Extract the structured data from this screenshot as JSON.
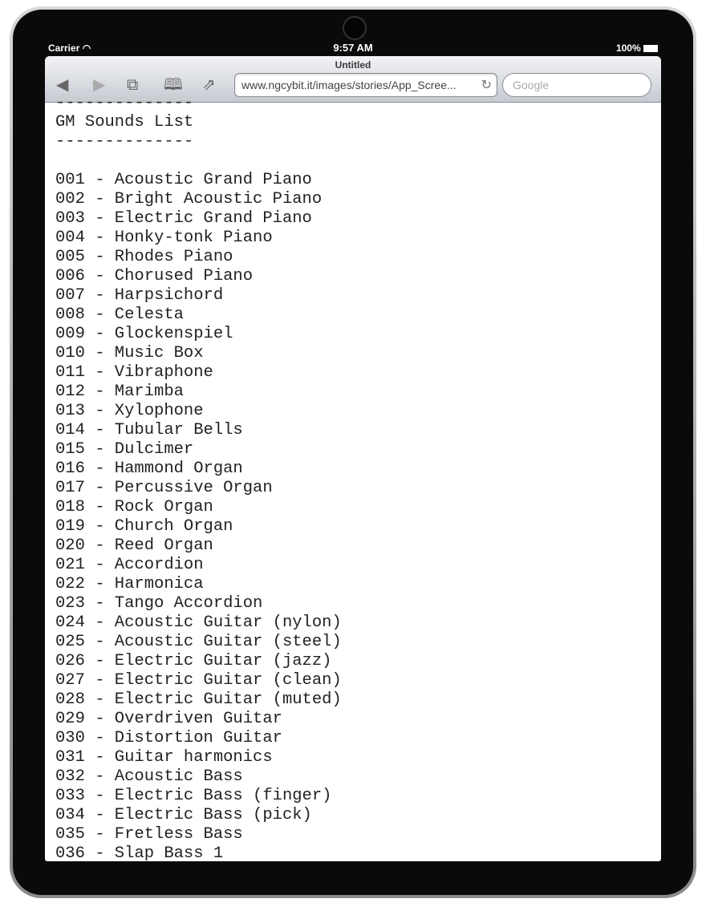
{
  "status": {
    "carrier": "Carrier",
    "time": "9:57 AM",
    "battery": "100%"
  },
  "browser": {
    "title": "Untitled",
    "url": "www.ngcybit.it/images/stories/App_Scree...",
    "search_placeholder": "Google"
  },
  "content": {
    "lines": [
      "--------------",
      "GM Sounds List",
      "--------------",
      "",
      "001 - Acoustic Grand Piano",
      "002 - Bright Acoustic Piano",
      "003 - Electric Grand Piano",
      "004 - Honky-tonk Piano",
      "005 - Rhodes Piano",
      "006 - Chorused Piano",
      "007 - Harpsichord",
      "008 - Celesta",
      "009 - Glockenspiel",
      "010 - Music Box",
      "011 - Vibraphone",
      "012 - Marimba",
      "013 - Xylophone",
      "014 - Tubular Bells",
      "015 - Dulcimer",
      "016 - Hammond Organ",
      "017 - Percussive Organ",
      "018 - Rock Organ",
      "019 - Church Organ",
      "020 - Reed Organ",
      "021 - Accordion",
      "022 - Harmonica",
      "023 - Tango Accordion",
      "024 - Acoustic Guitar (nylon)",
      "025 - Acoustic Guitar (steel)",
      "026 - Electric Guitar (jazz)",
      "027 - Electric Guitar (clean)",
      "028 - Electric Guitar (muted)",
      "029 - Overdriven Guitar",
      "030 - Distortion Guitar",
      "031 - Guitar harmonics",
      "032 - Acoustic Bass",
      "033 - Electric Bass (finger)",
      "034 - Electric Bass (pick)",
      "035 - Fretless Bass",
      "036 - Slap Bass 1"
    ]
  }
}
